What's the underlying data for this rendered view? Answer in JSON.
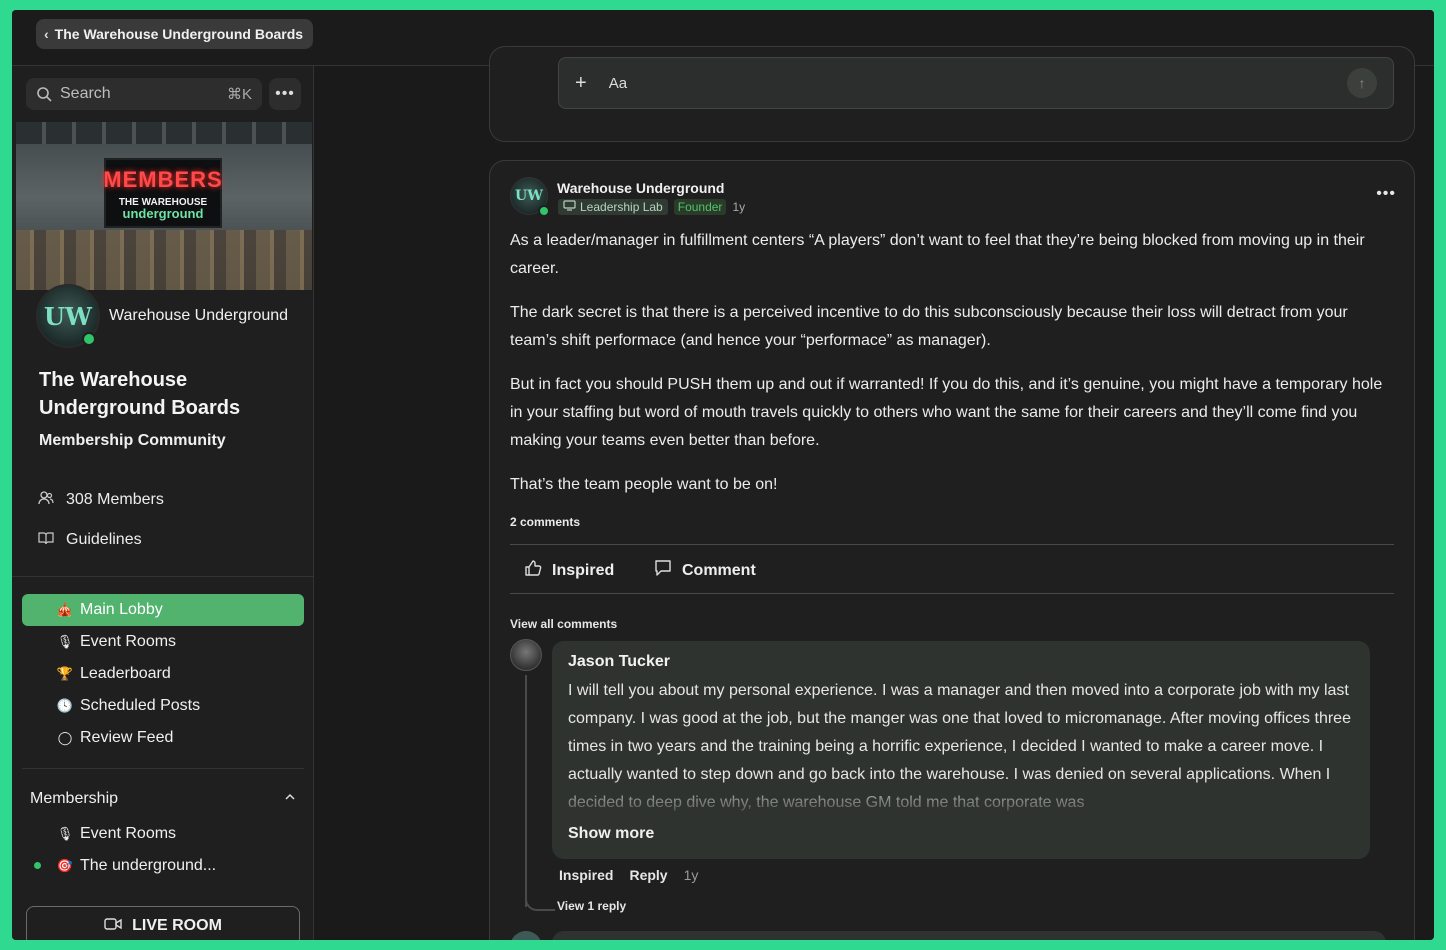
{
  "topbar": {
    "back_label": "The Warehouse Underground Boards"
  },
  "sidebar": {
    "search_placeholder": "Search",
    "search_shortcut": "⌘K",
    "banner": {
      "sign_main": "MEMBERS",
      "sign_line1": "THE WAREHOUSE",
      "sign_line2": "underground"
    },
    "owner": {
      "name": "Warehouse Underground",
      "avatar_text": "UW"
    },
    "group_title": "The Warehouse Underground Boards",
    "group_subtitle": "Membership Community",
    "members_label": "308 Members",
    "guidelines_label": "Guidelines",
    "nav": [
      {
        "label": "Main Lobby",
        "icon": "🎪",
        "active": true
      },
      {
        "label": "Event Rooms",
        "icon": "🎙"
      },
      {
        "label": "Leaderboard",
        "icon": "🏆"
      },
      {
        "label": "Scheduled Posts",
        "icon": "🕓"
      },
      {
        "label": "Review Feed",
        "icon": "◯"
      }
    ],
    "section": {
      "title": "Membership",
      "items": [
        {
          "label": "Event Rooms",
          "icon": "🎙"
        },
        {
          "label": "The underground...",
          "icon": "🎯"
        }
      ]
    },
    "live_room_label": "LIVE ROOM"
  },
  "composer": {
    "placeholder": "Aa"
  },
  "post": {
    "author": "Warehouse Underground",
    "avatar_text": "UW",
    "badge_lab": "Leadership Lab",
    "badge_role": "Founder",
    "time": "1y",
    "paragraphs": [
      "As a leader/manager in fulfillment centers “A players” don’t want to feel that they’re being blocked from moving up in their career.",
      "The dark secret is that there is a perceived incentive to do this subconsciously because their loss will detract from your team’s shift performace (and hence your “performace” as manager).",
      "But in fact you should PUSH them up and out if warranted! If you do this, and it’s genuine, you might have a temporary hole in your staffing but word of mouth travels quickly to others who want the same for their careers and they’ll come find you making your teams even better than before.",
      "That’s the team people want to be on!"
    ],
    "comments_count": "2 comments",
    "inspired_label": "Inspired",
    "comment_label": "Comment",
    "view_all_label": "View all comments"
  },
  "comment": {
    "author": "Jason Tucker",
    "text": "I will tell you about my personal experience. I was a manager and then moved into a corporate job with my last company. I was good at the job, but the manger was one that loved to micromanage. After moving offices three times in two years and the training being a horrific experience, I decided I wanted to make a career move. I actually wanted to step down and go back into the warehouse. I was denied on several applications. When I decided to deep dive why, the warehouse GM told me that corporate was",
    "show_more": "Show more",
    "inspired": "Inspired",
    "reply": "Reply",
    "time": "1y",
    "view_reply": "View 1 reply"
  },
  "colors": {
    "accent": "#52b36e",
    "online": "#31c56b",
    "frame": "#2fd98f"
  }
}
